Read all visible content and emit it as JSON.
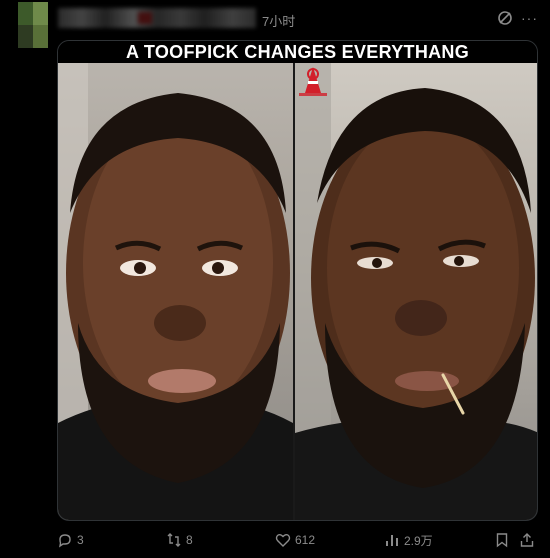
{
  "post": {
    "time": "7小时",
    "caption": "A TOOFPICK CHANGES EVERYTHANG"
  },
  "actions": {
    "replies": "3",
    "reposts": "8",
    "likes": "612",
    "views": "2.9万"
  },
  "icons": [
    "grok-icon",
    "more-icon",
    "reply-icon",
    "repost-icon",
    "like-icon",
    "views-icon",
    "bookmark-icon",
    "share-icon"
  ],
  "colors": {
    "background": "#000000",
    "muted_text": "#8b8b8b",
    "caption_text": "#ffffff",
    "logo_red": "#d21f2a"
  }
}
